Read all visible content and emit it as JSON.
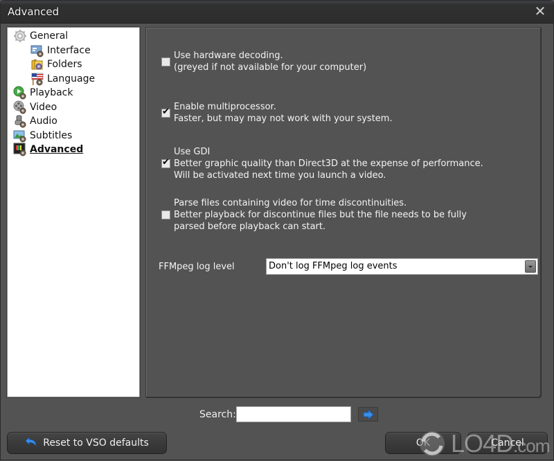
{
  "window": {
    "title": "Advanced",
    "close_icon": "close-icon"
  },
  "sidebar": {
    "items": [
      {
        "label": "General",
        "icon": "gear-icon",
        "level": 0,
        "selected": false
      },
      {
        "label": "Interface",
        "icon": "interface-window-icon",
        "level": 1,
        "selected": false
      },
      {
        "label": "Folders",
        "icon": "folder-icon",
        "level": 1,
        "selected": false
      },
      {
        "label": "Language",
        "icon": "flag-icon",
        "level": 1,
        "selected": false
      },
      {
        "label": "Playback",
        "icon": "play-icon",
        "level": 0,
        "selected": false
      },
      {
        "label": "Video",
        "icon": "film-reel-icon",
        "level": 0,
        "selected": false
      },
      {
        "label": "Audio",
        "icon": "speaker-icon",
        "level": 0,
        "selected": false
      },
      {
        "label": "Subtitles",
        "icon": "picture-icon",
        "level": 0,
        "selected": false
      },
      {
        "label": "Advanced",
        "icon": "monitor-icon",
        "level": 0,
        "selected": true
      }
    ]
  },
  "options": [
    {
      "checked": false,
      "lines": [
        "Use hardware decoding.",
        "(greyed if not  available for your computer)"
      ]
    },
    {
      "checked": true,
      "lines": [
        "Enable multiprocessor.",
        "Faster, but may may not work with your system."
      ]
    },
    {
      "checked": true,
      "lines": [
        "Use GDI",
        "Better graphic quality than Direct3D at the expense of performance.",
        "Will be activated next time you launch a video."
      ]
    },
    {
      "checked": false,
      "lines": [
        "Parse files containing video for time discontinuities.",
        "Better playback for discontinue files but the file needs to be fully",
        "parsed before playback can start."
      ]
    }
  ],
  "ffmpeg": {
    "label": "FFMpeg log level",
    "selected": "Don't log FFMpeg log events"
  },
  "search": {
    "label": "Search:",
    "value": "",
    "placeholder": ""
  },
  "buttons": {
    "reset": "Reset to VSO defaults",
    "ok": "OK",
    "cancel": "Cancel"
  },
  "watermark": {
    "text": "LO4D",
    "suffix": ".com"
  },
  "colors": {
    "background": "#535353",
    "titlebar": "#2e2e2e",
    "accent_arrow": "#3a8ee6"
  }
}
